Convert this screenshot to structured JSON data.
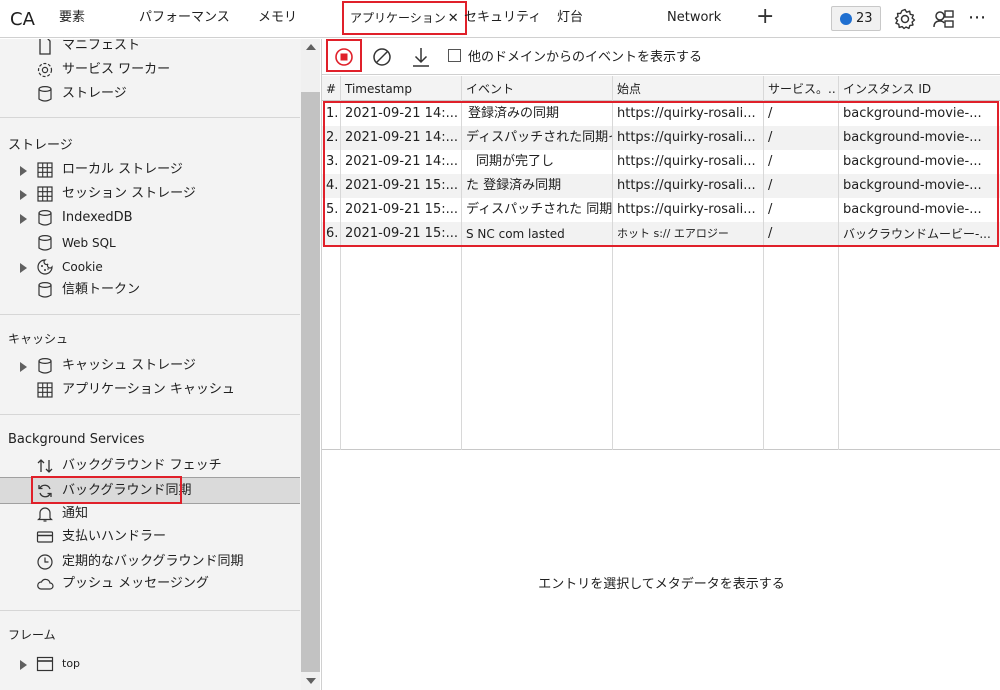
{
  "tabs": {
    "ca": "CA",
    "elements": "要素",
    "performance": "パフォーマンス",
    "memory": "メモリ",
    "application": "アプリケーション",
    "security": "セキュリティ",
    "lighthouse": "灯台",
    "network": "Network",
    "issues_count": "23"
  },
  "sidebar": {
    "app_items": [
      "マニフェスト",
      "サービス ワーカー",
      "ストレージ"
    ],
    "storage_title": "ストレージ",
    "storage_items": [
      "ローカル ストレージ",
      "セッション ストレージ",
      "IndexedDB",
      "Web SQL",
      "Cookie",
      "信頼トークン"
    ],
    "cache_title": "キャッシュ",
    "cache_items": [
      "キャッシュ ストレージ",
      "アプリケーション キャッシュ"
    ],
    "bg_title": "Background Services",
    "bg_items": [
      "バックグラウンド フェッチ",
      "バックグラウンド同期",
      "通知",
      "支払いハンドラー",
      "定期的なバックグラウンド同期",
      "プッシュ メッセージング"
    ],
    "frames_title": "フレーム",
    "frames_items": [
      "top"
    ]
  },
  "toolbar": {
    "show_other_domains": "他のドメインからのイベントを表示する"
  },
  "table": {
    "headers": [
      "#",
      "Timestamp",
      "イベント",
      "始点",
      "サービス。..",
      "インスタンス ID"
    ],
    "rows": [
      [
        "1.",
        "2021-09-21 14:...",
        "登録済みの同期",
        "https://quirky-rosali...",
        "/",
        "background-movie-..."
      ],
      [
        "2.",
        "2021-09-21 14:...",
        "ディスパッチされた同期イベ",
        "https://quirky-rosali...",
        "/",
        "background-movie-..."
      ],
      [
        "3.",
        "2021-09-21 14:...",
        "同期が完了し",
        "https://quirky-rosali...",
        "/",
        "background-movie-..."
      ],
      [
        "4.",
        "2021-09-21 15:...",
        "た 登録済み同期",
        "https://quirky-rosali...",
        "/",
        "background-movie-..."
      ],
      [
        "5.",
        "2021-09-21 15:...",
        "ディスパッチされた 同期イベ",
        "https://quirky-rosali...",
        "/",
        "background-movie-..."
      ],
      [
        "6.",
        "2021-09-21 15:...",
        "S NC com lasted",
        "ホット s:// エアロジー",
        "/",
        "バックラウンドムービー-..."
      ]
    ]
  },
  "detail": {
    "message": "エントリを選択してメタデータを表示する"
  }
}
